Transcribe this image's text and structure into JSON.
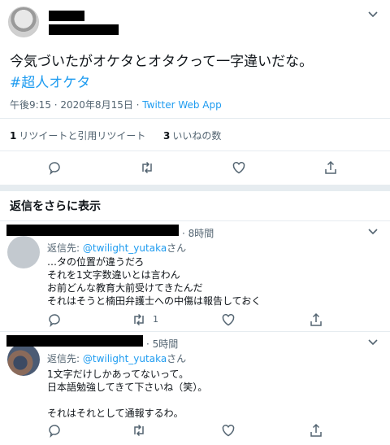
{
  "tweet": {
    "text": "今気づいたがオケタとオタクって一字違いだな。",
    "hashtag": "#超人オケタ",
    "timestamp": "午後9:15 · 2020年8月15日",
    "separator": " · ",
    "app": "Twitter Web App",
    "retweets_count": "1",
    "retweets_label": "リツイートと引用リツイート",
    "likes_count": "3",
    "likes_label": "いいねの数"
  },
  "replies_section": {
    "show_more_label": "返信をさらに表示"
  },
  "replies": [
    {
      "time": "8時間",
      "replying_prefix": "返信先: ",
      "replying_handle": "@twilight_yutaka",
      "replying_suffix": "さん",
      "body": "…タの位置が違うだろ\nそれを1文字数違いとは言わん\nお前どんな教育大前受けてきたんだ\nそれはそうと楠田弁護士への中傷は報告しておく",
      "retweet_count": "1"
    },
    {
      "time": "5時間",
      "replying_prefix": "返信先: ",
      "replying_handle": "@twilight_yutaka",
      "replying_suffix": "さん",
      "body": "1文字だけしかあってないって。\n日本語勉強してきて下さいね（笑）。\n\nそれはそれとして通報するわ。"
    }
  ],
  "colors": {
    "accent": "#1d9bf0",
    "muted": "#536471",
    "text": "#0f1419",
    "border": "#e6ecf0"
  },
  "icons": [
    "chevron-down-icon",
    "reply-icon",
    "retweet-icon",
    "like-icon",
    "share-icon"
  ]
}
